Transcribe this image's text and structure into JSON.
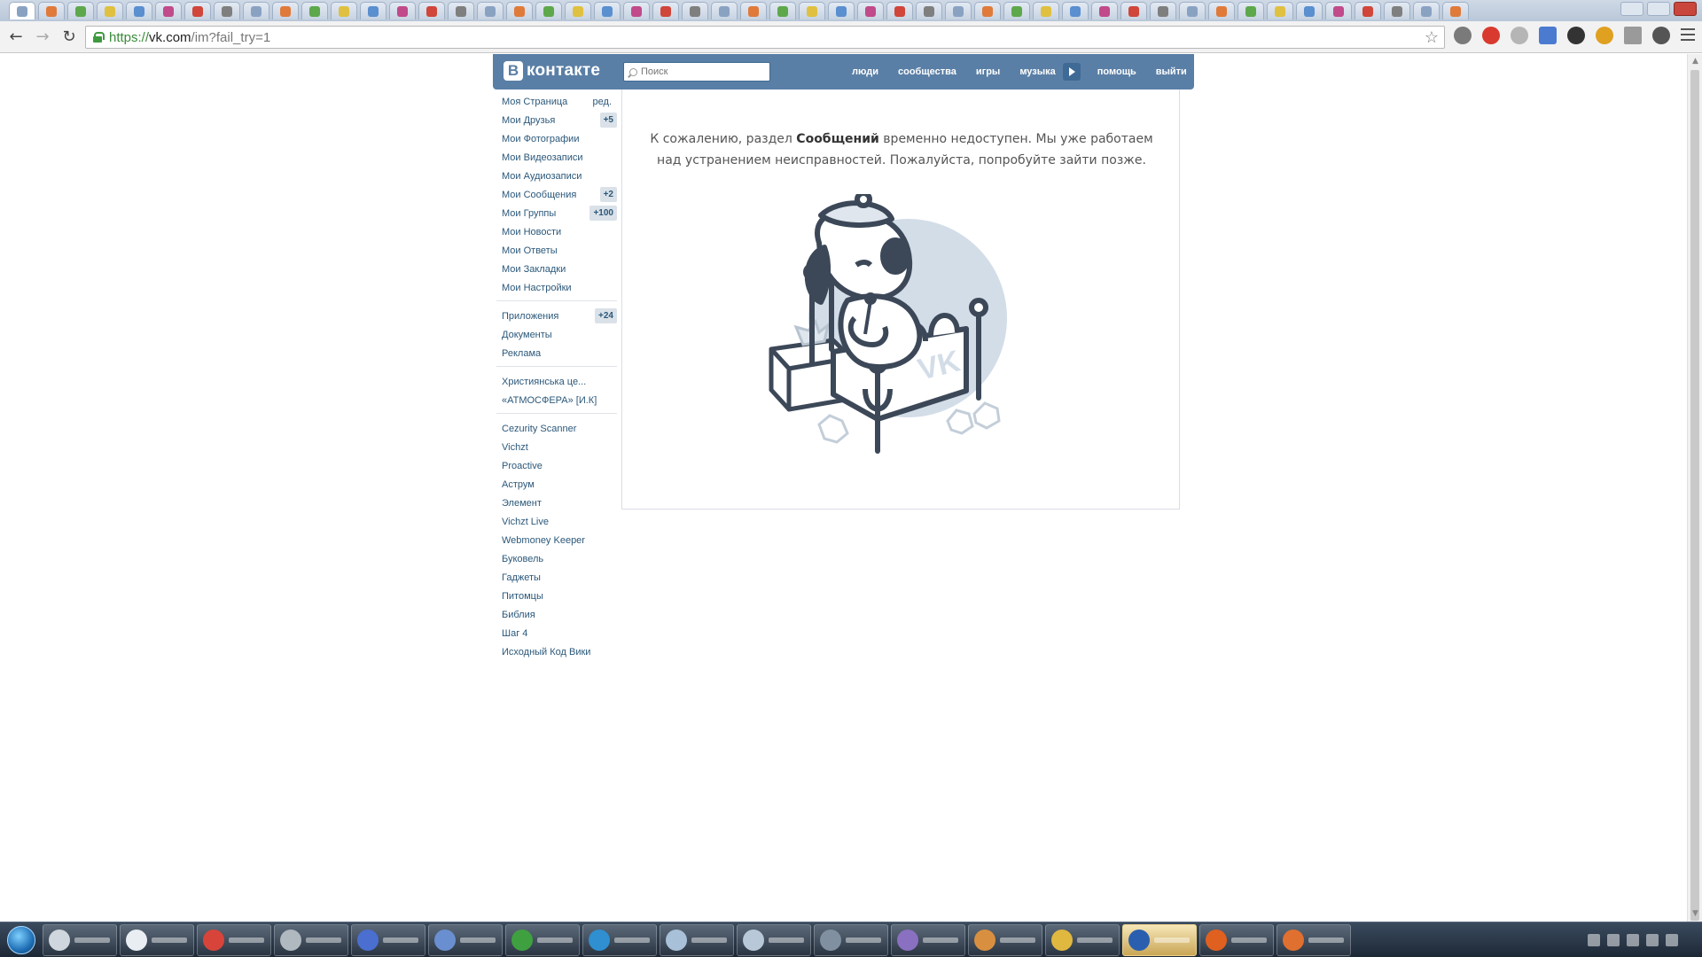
{
  "browser": {
    "url_scheme": "https://",
    "url_host": "vk.com",
    "url_path": "/im?fail_try=1",
    "tab_count": 50
  },
  "header": {
    "logo_letter": "В",
    "logo_text": "контакте",
    "search_placeholder": "Поиск",
    "nav": {
      "people": "люди",
      "communities": "сообщества",
      "games": "игры",
      "music": "музыка",
      "help": "помощь",
      "logout": "выйти"
    }
  },
  "sidebar": {
    "edit_label": "ред.",
    "main_items": [
      {
        "label": "Моя Страница",
        "badge": ""
      },
      {
        "label": "Мои Друзья",
        "badge": "+5"
      },
      {
        "label": "Мои Фотографии",
        "badge": ""
      },
      {
        "label": "Мои Видеозаписи",
        "badge": ""
      },
      {
        "label": "Мои Аудиозаписи",
        "badge": ""
      },
      {
        "label": "Мои Сообщения",
        "badge": "+2"
      },
      {
        "label": "Мои Группы",
        "badge": "+100"
      },
      {
        "label": "Мои Новости",
        "badge": ""
      },
      {
        "label": "Мои Ответы",
        "badge": ""
      },
      {
        "label": "Мои Закладки",
        "badge": ""
      },
      {
        "label": "Мои Настройки",
        "badge": ""
      }
    ],
    "service_items": [
      {
        "label": "Приложения",
        "badge": "+24"
      },
      {
        "label": "Документы",
        "badge": ""
      },
      {
        "label": "Реклама",
        "badge": ""
      }
    ],
    "group_items": [
      {
        "label": "Християнська це..."
      },
      {
        "label": "«АТМОСФЕРА» [И.К]"
      }
    ],
    "app_items": [
      {
        "label": "Cezurity Scanner"
      },
      {
        "label": "Vichzt"
      },
      {
        "label": "Proactive"
      },
      {
        "label": "Аструм"
      },
      {
        "label": "Элемент"
      },
      {
        "label": "Vichzt Live"
      },
      {
        "label": "Webmoney Keeper"
      },
      {
        "label": "Буковель"
      },
      {
        "label": "Гаджеты"
      },
      {
        "label": "Питомцы"
      },
      {
        "label": "Библия"
      },
      {
        "label": "Шаг 4"
      },
      {
        "label": "Исходный Код Вики"
      }
    ]
  },
  "main": {
    "message_before": "К сожалению, раздел ",
    "message_bold": "Сообщений",
    "message_after_line1": " временно недоступен. Мы уже работаем",
    "message_line2": "над устранением неисправностей. Пожалуйста, попробуйте зайти позже.",
    "illustration": "sick-dog-in-bed"
  },
  "colors": {
    "vk_blue": "#5a7fa6",
    "link": "#2b587a",
    "badge_bg": "#dae1e8"
  }
}
